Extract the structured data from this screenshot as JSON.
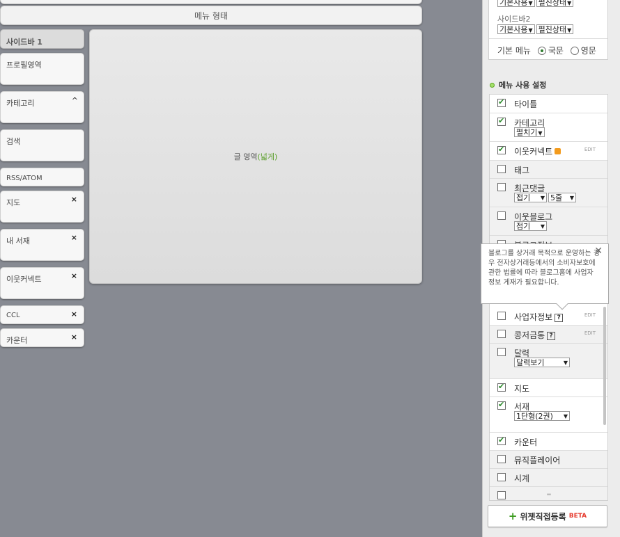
{
  "canvas": {
    "menu_area_label": "메뉴 형태",
    "sidebar_title": "사이드바 1",
    "content_label": "글 영역",
    "content_wide": "(넓게)",
    "sidebar_items": [
      {
        "label": "프로필영역",
        "control": ""
      },
      {
        "label": "카테고리",
        "control": "^"
      },
      {
        "label": "검색",
        "control": ""
      },
      {
        "label": "RSS/ATOM",
        "control": ""
      },
      {
        "label": "지도",
        "control": "×"
      },
      {
        "label": "내 서재",
        "control": "×"
      },
      {
        "label": "이웃커넥트",
        "control": "×"
      },
      {
        "label": "CCL",
        "control": "×"
      },
      {
        "label": "카운터",
        "control": "×"
      }
    ]
  },
  "panel": {
    "sidebar1_select_a": "기본사용",
    "sidebar1_select_b": "펼친상태",
    "sidebar2_label": "사이드바2",
    "sidebar2_select_a": "기본사용",
    "sidebar2_select_b": "펼친상태",
    "basic_menu_label": "기본 메뉴",
    "radio_korean": "국문",
    "radio_english": "영문",
    "section_title": "메뉴 사용 설정",
    "items": {
      "title": "타이틀",
      "category": "카테고리",
      "category_select": "펼치기",
      "neighbor_connect": "이웃커넥트",
      "tag": "태그",
      "recent_comments": "최근댓글",
      "recent_comments_select": "접기",
      "recent_comments_count": "5줄",
      "neighbor_blog": "이웃블로그",
      "neighbor_blog_select": "접기",
      "blog_info": "블로그정보",
      "business_info": "사업자정보",
      "donation": "콩저금통",
      "calendar": "달력",
      "calendar_select": "달력보기",
      "map": "지도",
      "library": "서재",
      "library_select": "1단형(2권)",
      "counter": "카운터",
      "music_player": "뮤직플레이어",
      "clock": "시계"
    },
    "edit_label": "EDIT",
    "help_mark": "?",
    "tooltip_text": "블로그를 상거래 목적으로 운영하는 경우 전자상거래등에서의 소비자보호에 관한 법률에 따라 블로그홈에 사업자 정보 게재가 필요합니다.",
    "tooltip_close": "✕",
    "add_button_label": "위젯직접등록",
    "add_button_beta": "BETA",
    "add_button_plus": "+"
  }
}
